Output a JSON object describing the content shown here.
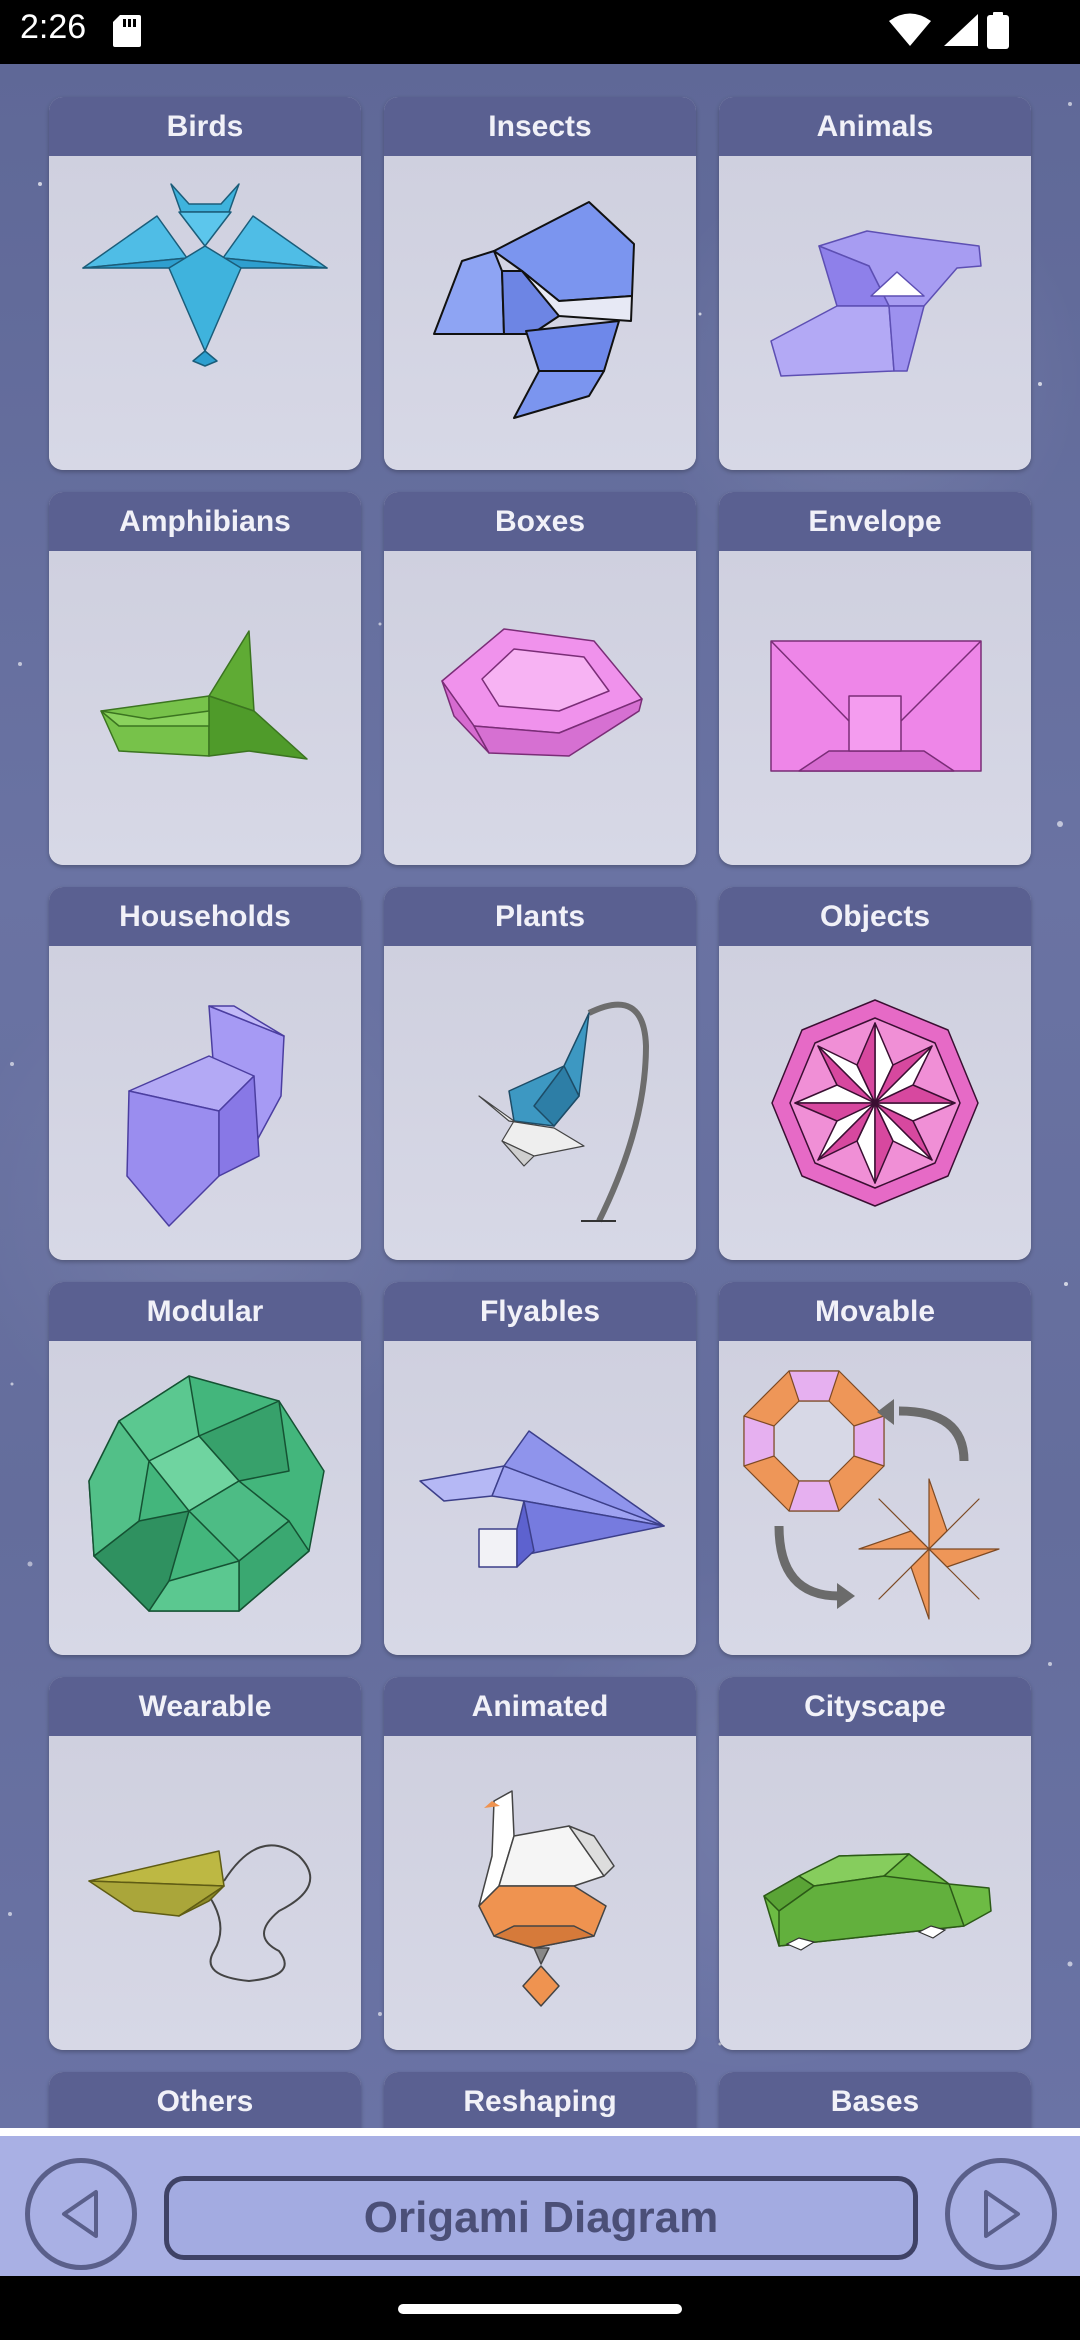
{
  "status": {
    "time": "2:26",
    "icons": [
      "sd-card-icon",
      "wifi-icon",
      "signal-icon",
      "battery-icon"
    ]
  },
  "categories": [
    {
      "label": "Birds",
      "icon": "origami-bird-icon",
      "color": "#3fb3dd"
    },
    {
      "label": "Insects",
      "icon": "origami-insect-icon",
      "color": "#7f9bf0"
    },
    {
      "label": "Animals",
      "icon": "origami-animal-icon",
      "color": "#a79cf2"
    },
    {
      "label": "Amphibians",
      "icon": "origami-frog-icon",
      "color": "#6db23f"
    },
    {
      "label": "Boxes",
      "icon": "origami-box-icon",
      "color": "#e57ee0"
    },
    {
      "label": "Envelope",
      "icon": "origami-envelope-icon",
      "color": "#ee86e8"
    },
    {
      "label": "Households",
      "icon": "origami-chair-icon",
      "color": "#a18cf2"
    },
    {
      "label": "Plants",
      "icon": "origami-flower-icon",
      "color": "#3d98c2"
    },
    {
      "label": "Objects",
      "icon": "origami-star-ornament-icon",
      "color": "#e66ac6"
    },
    {
      "label": "Modular",
      "icon": "origami-modular-ball-icon",
      "color": "#43b67c"
    },
    {
      "label": "Flyables",
      "icon": "origami-plane-icon",
      "color": "#8f94ec"
    },
    {
      "label": "Movable",
      "icon": "origami-transforming-star-icon",
      "color": "#ee9658"
    },
    {
      "label": "Wearable",
      "icon": "origami-kite-icon",
      "color": "#aaa63a"
    },
    {
      "label": "Animated",
      "icon": "origami-animated-bird-icon",
      "color": "#ef9350"
    },
    {
      "label": "Cityscape",
      "icon": "origami-car-icon",
      "color": "#6dbb44"
    },
    {
      "label": "Others",
      "icon": "",
      "color": "#d2d3e2"
    },
    {
      "label": "Reshaping",
      "icon": "",
      "color": "#d2d3e2"
    },
    {
      "label": "Bases",
      "icon": "",
      "color": "#d2d3e2"
    }
  ],
  "bottom_bar": {
    "title": "Origami Diagram",
    "prev_icon": "triangle-left-icon",
    "next_icon": "triangle-right-icon"
  },
  "colors": {
    "header_bg": "#5a6091",
    "card_bg": "#d2d3e2",
    "bottom_bar_bg": "#a9b0e4",
    "title_text": "#4b4f77"
  }
}
